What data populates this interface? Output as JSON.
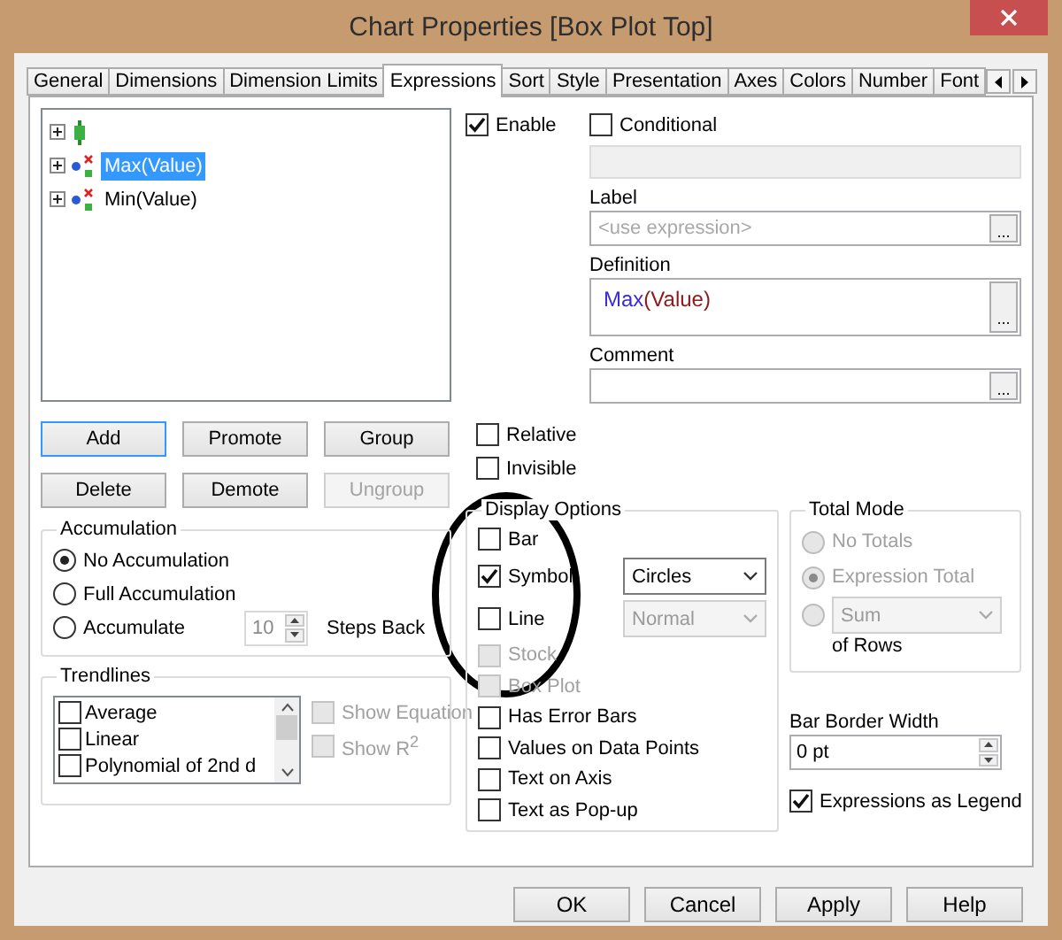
{
  "window": {
    "title": "Chart Properties [Box Plot Top]"
  },
  "tabs": [
    {
      "label": "General",
      "selected": false
    },
    {
      "label": "Dimensions",
      "selected": false
    },
    {
      "label": "Dimension Limits",
      "selected": false
    },
    {
      "label": "Expressions",
      "selected": true
    },
    {
      "label": "Sort",
      "selected": false
    },
    {
      "label": "Style",
      "selected": false
    },
    {
      "label": "Presentation",
      "selected": false
    },
    {
      "label": "Axes",
      "selected": false
    },
    {
      "label": "Colors",
      "selected": false
    },
    {
      "label": "Number",
      "selected": false
    },
    {
      "label": "Font",
      "selected": false
    }
  ],
  "expressions_tree": [
    {
      "kind": "group",
      "expanded": false,
      "selected": false
    },
    {
      "kind": "expression",
      "label": "Max(Value)",
      "expanded": false,
      "selected": true
    },
    {
      "kind": "expression",
      "label": "Min(Value)",
      "expanded": false,
      "selected": false
    }
  ],
  "expression_buttons": [
    {
      "label": "Add",
      "disabled": false,
      "focused": true
    },
    {
      "label": "Promote",
      "disabled": false,
      "focused": false
    },
    {
      "label": "Group",
      "disabled": false,
      "focused": false
    },
    {
      "label": "Delete",
      "disabled": false,
      "focused": false
    },
    {
      "label": "Demote",
      "disabled": false,
      "focused": false
    },
    {
      "label": "Ungroup",
      "disabled": true,
      "focused": false
    }
  ],
  "accumulation": {
    "title": "Accumulation",
    "options": [
      {
        "label": "No Accumulation",
        "selected": true
      },
      {
        "label": "Full Accumulation",
        "selected": false
      },
      {
        "label": "Accumulate",
        "selected": false
      }
    ],
    "steps": {
      "value": "10",
      "label": "Steps Back",
      "disabled": true
    }
  },
  "trendlines": {
    "title": "Trendlines",
    "items": [
      {
        "label": "Average",
        "checked": false
      },
      {
        "label": "Linear",
        "checked": false
      },
      {
        "label": "Polynomial of 2nd d",
        "checked": false
      }
    ],
    "options": [
      {
        "label": "Show Equation",
        "checked": false,
        "disabled": true
      },
      {
        "label": "Show R$^{2}$",
        "checked": false,
        "disabled": true
      }
    ]
  },
  "enable": {
    "label": "Enable",
    "checked": true
  },
  "conditional": {
    "label": "Conditional",
    "checked": false
  },
  "label_field": {
    "label": "Label",
    "placeholder": "<use expression>",
    "button": "..."
  },
  "definition": {
    "label": "Definition",
    "tokens": [
      {
        "text": "Max",
        "color": "#3a2bd6"
      },
      {
        "text": "(Value)",
        "color": "#8b1a1a"
      }
    ],
    "button": "..."
  },
  "comment": {
    "label": "Comment",
    "button": "..."
  },
  "flags": [
    {
      "label": "Relative",
      "checked": false
    },
    {
      "label": "Invisible",
      "checked": false
    }
  ],
  "display_options": {
    "title": "Display Options",
    "items": [
      {
        "label": "Bar",
        "checked": false,
        "disabled": false
      },
      {
        "label": "Symbol",
        "checked": true,
        "disabled": false,
        "dropdown": {
          "value": "Circles",
          "disabled": false
        }
      },
      {
        "label": "Line",
        "checked": false,
        "disabled": false,
        "dropdown": {
          "value": "Normal",
          "disabled": true
        }
      },
      {
        "label": "Stock",
        "checked": false,
        "disabled": true
      },
      {
        "label": "Box Plot",
        "checked": false,
        "disabled": true
      },
      {
        "label": "Has Error Bars",
        "checked": false,
        "disabled": false
      },
      {
        "label": "Values on Data Points",
        "checked": false,
        "disabled": false
      },
      {
        "label": "Text on Axis",
        "checked": false,
        "disabled": false
      },
      {
        "label": "Text as Pop-up",
        "checked": false,
        "disabled": false
      }
    ]
  },
  "total_mode": {
    "title": "Total Mode",
    "disabled": true,
    "options": [
      {
        "label": "No Totals",
        "selected": false
      },
      {
        "label": "Expression Total",
        "selected": true
      },
      {
        "dropdown": "Sum",
        "selected": false
      }
    ],
    "suffix": "of Rows"
  },
  "bar_border_width": {
    "label": "Bar Border Width",
    "value": "0 pt"
  },
  "expressions_as_legend": {
    "label": "Expressions as Legend",
    "checked": true
  },
  "buttons": [
    {
      "label": "OK"
    },
    {
      "label": "Cancel"
    },
    {
      "label": "Apply"
    },
    {
      "label": "Help"
    }
  ]
}
